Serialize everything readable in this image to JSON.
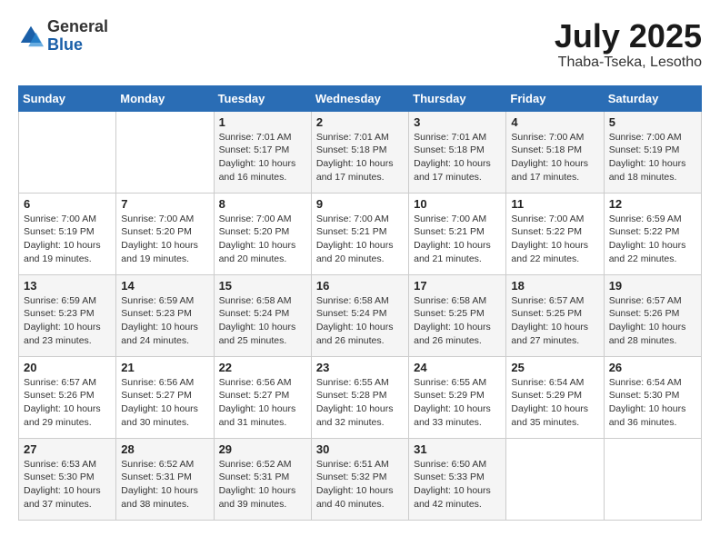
{
  "header": {
    "logo_general": "General",
    "logo_blue": "Blue",
    "month_year": "July 2025",
    "location": "Thaba-Tseka, Lesotho"
  },
  "weekdays": [
    "Sunday",
    "Monday",
    "Tuesday",
    "Wednesday",
    "Thursday",
    "Friday",
    "Saturday"
  ],
  "weeks": [
    [
      {
        "day": "",
        "info": ""
      },
      {
        "day": "",
        "info": ""
      },
      {
        "day": "1",
        "info": "Sunrise: 7:01 AM\nSunset: 5:17 PM\nDaylight: 10 hours\nand 16 minutes."
      },
      {
        "day": "2",
        "info": "Sunrise: 7:01 AM\nSunset: 5:18 PM\nDaylight: 10 hours\nand 17 minutes."
      },
      {
        "day": "3",
        "info": "Sunrise: 7:01 AM\nSunset: 5:18 PM\nDaylight: 10 hours\nand 17 minutes."
      },
      {
        "day": "4",
        "info": "Sunrise: 7:00 AM\nSunset: 5:18 PM\nDaylight: 10 hours\nand 17 minutes."
      },
      {
        "day": "5",
        "info": "Sunrise: 7:00 AM\nSunset: 5:19 PM\nDaylight: 10 hours\nand 18 minutes."
      }
    ],
    [
      {
        "day": "6",
        "info": "Sunrise: 7:00 AM\nSunset: 5:19 PM\nDaylight: 10 hours\nand 19 minutes."
      },
      {
        "day": "7",
        "info": "Sunrise: 7:00 AM\nSunset: 5:20 PM\nDaylight: 10 hours\nand 19 minutes."
      },
      {
        "day": "8",
        "info": "Sunrise: 7:00 AM\nSunset: 5:20 PM\nDaylight: 10 hours\nand 20 minutes."
      },
      {
        "day": "9",
        "info": "Sunrise: 7:00 AM\nSunset: 5:21 PM\nDaylight: 10 hours\nand 20 minutes."
      },
      {
        "day": "10",
        "info": "Sunrise: 7:00 AM\nSunset: 5:21 PM\nDaylight: 10 hours\nand 21 minutes."
      },
      {
        "day": "11",
        "info": "Sunrise: 7:00 AM\nSunset: 5:22 PM\nDaylight: 10 hours\nand 22 minutes."
      },
      {
        "day": "12",
        "info": "Sunrise: 6:59 AM\nSunset: 5:22 PM\nDaylight: 10 hours\nand 22 minutes."
      }
    ],
    [
      {
        "day": "13",
        "info": "Sunrise: 6:59 AM\nSunset: 5:23 PM\nDaylight: 10 hours\nand 23 minutes."
      },
      {
        "day": "14",
        "info": "Sunrise: 6:59 AM\nSunset: 5:23 PM\nDaylight: 10 hours\nand 24 minutes."
      },
      {
        "day": "15",
        "info": "Sunrise: 6:58 AM\nSunset: 5:24 PM\nDaylight: 10 hours\nand 25 minutes."
      },
      {
        "day": "16",
        "info": "Sunrise: 6:58 AM\nSunset: 5:24 PM\nDaylight: 10 hours\nand 26 minutes."
      },
      {
        "day": "17",
        "info": "Sunrise: 6:58 AM\nSunset: 5:25 PM\nDaylight: 10 hours\nand 26 minutes."
      },
      {
        "day": "18",
        "info": "Sunrise: 6:57 AM\nSunset: 5:25 PM\nDaylight: 10 hours\nand 27 minutes."
      },
      {
        "day": "19",
        "info": "Sunrise: 6:57 AM\nSunset: 5:26 PM\nDaylight: 10 hours\nand 28 minutes."
      }
    ],
    [
      {
        "day": "20",
        "info": "Sunrise: 6:57 AM\nSunset: 5:26 PM\nDaylight: 10 hours\nand 29 minutes."
      },
      {
        "day": "21",
        "info": "Sunrise: 6:56 AM\nSunset: 5:27 PM\nDaylight: 10 hours\nand 30 minutes."
      },
      {
        "day": "22",
        "info": "Sunrise: 6:56 AM\nSunset: 5:27 PM\nDaylight: 10 hours\nand 31 minutes."
      },
      {
        "day": "23",
        "info": "Sunrise: 6:55 AM\nSunset: 5:28 PM\nDaylight: 10 hours\nand 32 minutes."
      },
      {
        "day": "24",
        "info": "Sunrise: 6:55 AM\nSunset: 5:29 PM\nDaylight: 10 hours\nand 33 minutes."
      },
      {
        "day": "25",
        "info": "Sunrise: 6:54 AM\nSunset: 5:29 PM\nDaylight: 10 hours\nand 35 minutes."
      },
      {
        "day": "26",
        "info": "Sunrise: 6:54 AM\nSunset: 5:30 PM\nDaylight: 10 hours\nand 36 minutes."
      }
    ],
    [
      {
        "day": "27",
        "info": "Sunrise: 6:53 AM\nSunset: 5:30 PM\nDaylight: 10 hours\nand 37 minutes."
      },
      {
        "day": "28",
        "info": "Sunrise: 6:52 AM\nSunset: 5:31 PM\nDaylight: 10 hours\nand 38 minutes."
      },
      {
        "day": "29",
        "info": "Sunrise: 6:52 AM\nSunset: 5:31 PM\nDaylight: 10 hours\nand 39 minutes."
      },
      {
        "day": "30",
        "info": "Sunrise: 6:51 AM\nSunset: 5:32 PM\nDaylight: 10 hours\nand 40 minutes."
      },
      {
        "day": "31",
        "info": "Sunrise: 6:50 AM\nSunset: 5:33 PM\nDaylight: 10 hours\nand 42 minutes."
      },
      {
        "day": "",
        "info": ""
      },
      {
        "day": "",
        "info": ""
      }
    ]
  ]
}
